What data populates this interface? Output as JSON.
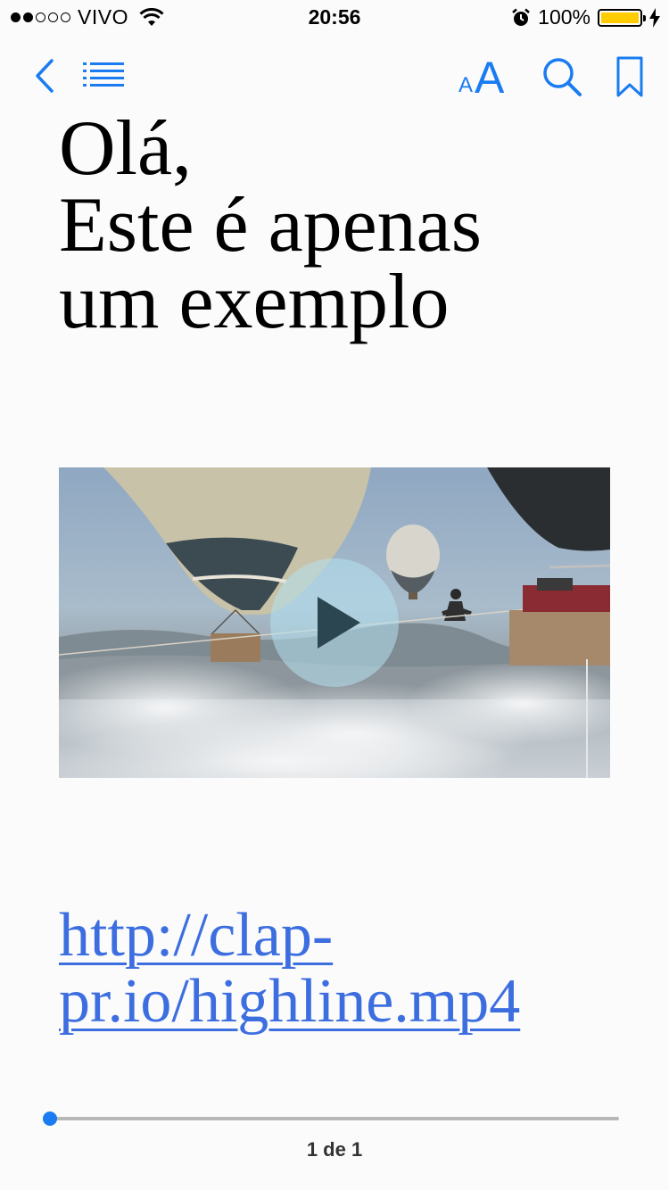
{
  "status_bar": {
    "carrier": "VIVO",
    "time": "20:56",
    "battery_percent": "100%",
    "signal_bars_filled": 2,
    "signal_bars_total": 5,
    "battery_color": "#ffcc00"
  },
  "toolbar": {
    "back_icon": "chevron-left-icon",
    "toc_icon": "list-icon",
    "font_small": "A",
    "font_large": "A",
    "search_icon": "search-icon",
    "bookmark_icon": "bookmark-icon",
    "accent_color": "#1a7cf0"
  },
  "content": {
    "title_lines": [
      "Olá,",
      "Este é apenas",
      "um exemplo"
    ],
    "video": {
      "play_icon": "play-icon"
    },
    "link_lines": [
      "http://clap-",
      "pr.io/highline.mp4"
    ],
    "link_color": "#3d6ee0"
  },
  "footer": {
    "page_indicator": "1 de 1",
    "progress_fraction": 0.0
  }
}
